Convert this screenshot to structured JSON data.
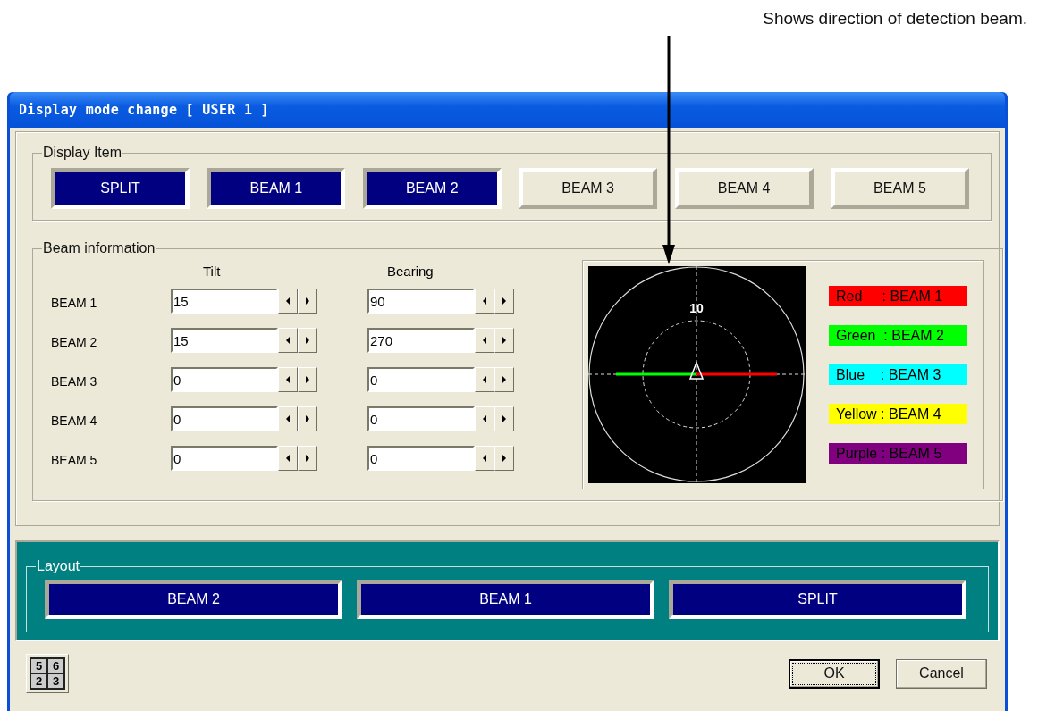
{
  "annotation": {
    "text": "Shows direction of detection beam."
  },
  "window": {
    "title": "Display mode change  [ USER 1 ]"
  },
  "display_item": {
    "label": "Display Item",
    "buttons": [
      {
        "label": "SPLIT",
        "selected": true
      },
      {
        "label": "BEAM 1",
        "selected": true
      },
      {
        "label": "BEAM 2",
        "selected": true
      },
      {
        "label": "BEAM 3",
        "selected": false
      },
      {
        "label": "BEAM 4",
        "selected": false
      },
      {
        "label": "BEAM 5",
        "selected": false
      }
    ]
  },
  "beam_information": {
    "label": "Beam information",
    "columns": [
      "Tilt",
      "Bearing"
    ],
    "rows": [
      {
        "name": "BEAM 1",
        "tilt": "15",
        "bearing": "90"
      },
      {
        "name": "BEAM 2",
        "tilt": "15",
        "bearing": "270"
      },
      {
        "name": "BEAM 3",
        "tilt": "0",
        "bearing": "0"
      },
      {
        "name": "BEAM 4",
        "tilt": "0",
        "bearing": "0"
      },
      {
        "name": "BEAM 5",
        "tilt": "0",
        "bearing": "0"
      }
    ],
    "range_label": "10",
    "legend": [
      {
        "text": "Red     : BEAM 1",
        "color": "#ff0000"
      },
      {
        "text": "Green  : BEAM 2",
        "color": "#00ff00"
      },
      {
        "text": "Blue    : BEAM 3",
        "color": "#00ffff"
      },
      {
        "text": "Yellow : BEAM 4",
        "color": "#ffff00"
      },
      {
        "text": "Purple : BEAM 5",
        "color": "#800080"
      }
    ]
  },
  "layout": {
    "label": "Layout",
    "buttons": [
      "BEAM 2",
      "BEAM 1",
      "SPLIT"
    ]
  },
  "grid_button": {
    "digits": [
      "5",
      "6",
      "2",
      "3"
    ]
  },
  "buttons": {
    "ok": "OK",
    "cancel": "Cancel"
  }
}
